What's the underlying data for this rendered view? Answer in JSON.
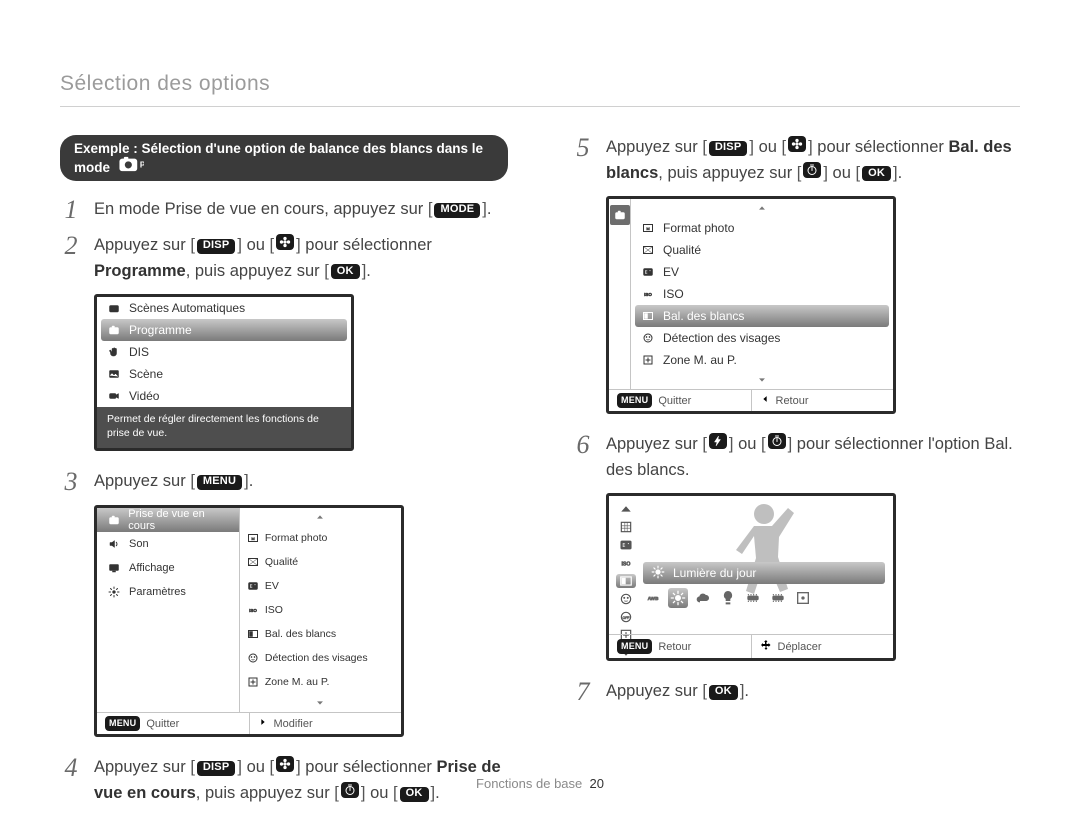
{
  "header": {
    "section_title": "Sélection des options"
  },
  "example_pill": {
    "text": "Exemple : Sélection d'une option de balance des blancs dans le mode",
    "icon": "camera-p-icon"
  },
  "steps": {
    "s1": {
      "num": "1",
      "pre": "En mode Prise de vue en cours, appuyez sur ",
      "key": "MODE",
      "post": "."
    },
    "s2": {
      "num": "2",
      "pre": "Appuyez sur ",
      "k1": "DISP",
      "mid1": " ou ",
      "icon": "flower-icon",
      "mid2": " pour sélectionner ",
      "bold": "Programme",
      "mid3": ", puis appuyez sur ",
      "k2": "OK",
      "post": "."
    },
    "s3": {
      "num": "3",
      "pre": "Appuyez sur ",
      "key": "MENU",
      "post": "."
    },
    "s4": {
      "num": "4",
      "pre": "Appuyez sur ",
      "k1": "DISP",
      "mid1": " ou ",
      "icon": "flower-icon",
      "mid2": " pour sélectionner ",
      "bold": "Prise de vue en cours",
      "mid3": ", puis appuyez sur ",
      "icon2": "timer-icon",
      "mid4": " ou ",
      "k2": "OK",
      "post": "."
    },
    "s5": {
      "num": "5",
      "pre": "Appuyez sur ",
      "k1": "DISP",
      "mid1": " ou ",
      "icon": "flower-icon",
      "mid2": " pour sélectionner ",
      "bold": "Bal. des blancs",
      "mid3": ", puis appuyez sur ",
      "icon2": "timer-icon",
      "mid4": " ou ",
      "k2": "OK",
      "post": "."
    },
    "s6": {
      "num": "6",
      "pre": "Appuyez sur ",
      "icon1": "flash-icon",
      "mid1": " ou ",
      "icon2": "timer-icon",
      "mid2": " pour sélectionner l'option Bal. des blancs.",
      "post": ""
    },
    "s7": {
      "num": "7",
      "pre": "Appuyez sur ",
      "key": "OK",
      "post": "."
    }
  },
  "panel_modes": {
    "items": [
      {
        "icon": "auto-icon",
        "label": "Scènes Automatiques"
      },
      {
        "icon": "camera-icon",
        "label": "Programme",
        "highlight": true
      },
      {
        "icon": "hand-icon",
        "label": "DIS"
      },
      {
        "icon": "scene-icon",
        "label": "Scène"
      },
      {
        "icon": "video-icon",
        "label": "Vidéo"
      }
    ],
    "desc": "Permet de régler directement les fonctions de prise de vue."
  },
  "panel_menu": {
    "left_tabs": [
      {
        "icon": "camera-icon",
        "active": true,
        "label": "Prise de vue en cours"
      },
      {
        "icon": "sound-icon",
        "label": "Son"
      },
      {
        "icon": "display-icon",
        "label": "Affichage"
      },
      {
        "icon": "gear-icon",
        "label": "Paramètres"
      }
    ],
    "right_items": [
      {
        "icon": "size-icon",
        "label": "Format photo"
      },
      {
        "icon": "quality-icon",
        "label": "Qualité"
      },
      {
        "icon": "ev-icon",
        "label": "EV"
      },
      {
        "icon": "iso-icon",
        "label": "ISO"
      },
      {
        "icon": "wb-icon",
        "label": "Bal. des blancs"
      },
      {
        "icon": "face-icon",
        "label": "Détection des visages"
      },
      {
        "icon": "zone-icon",
        "label": "Zone M. au P."
      }
    ],
    "footer": {
      "left_key": "MENU",
      "left_label": "Quitter",
      "right_icon": "right-icon",
      "right_label": "Modifier"
    }
  },
  "panel_shoot": {
    "side_tab": "camera-icon",
    "items": [
      {
        "icon": "size-icon",
        "label": "Format photo"
      },
      {
        "icon": "quality-icon",
        "label": "Qualité"
      },
      {
        "icon": "ev-icon",
        "label": "EV"
      },
      {
        "icon": "iso-icon",
        "label": "ISO"
      },
      {
        "icon": "wb-icon",
        "label": "Bal. des blancs",
        "highlight": true
      },
      {
        "icon": "face-icon",
        "label": "Détection des visages"
      },
      {
        "icon": "zone-icon",
        "label": "Zone M. au P."
      }
    ],
    "footer": {
      "left_key": "MENU",
      "left_label": "Quitter",
      "right_icon": "left-icon",
      "right_label": "Retour"
    }
  },
  "panel_wb": {
    "sidebar_icons": [
      "grid-icon",
      "ev-icon",
      "iso-icon",
      "wb-icon",
      "face-icon",
      "off-icon",
      "zone-icon"
    ],
    "sidebar_selected_index": 3,
    "label": "Lumière du jour",
    "options": [
      "awb-icon",
      "sun-icon",
      "cloud-icon",
      "tungsten-icon",
      "fluh-icon",
      "flul-icon",
      "custom-icon"
    ],
    "selected_index": 1,
    "footer": {
      "left_key": "MENU",
      "left_label": "Retour",
      "right_icon": "move-icon",
      "right_label": "Déplacer"
    }
  },
  "footer": {
    "label": "Fonctions de base",
    "page": "20"
  }
}
